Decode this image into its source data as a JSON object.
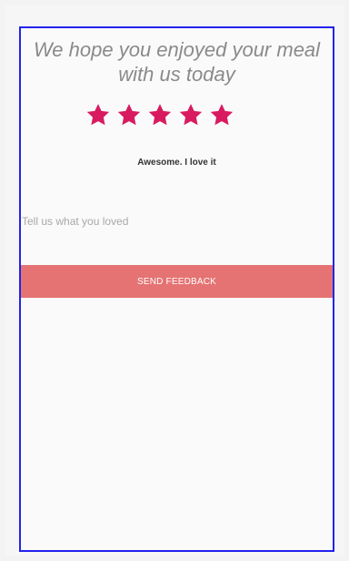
{
  "headline": "We hope you enjoyed your meal\nwith us today",
  "rating": {
    "value": 5,
    "max": 5,
    "star_color": "#d81b60",
    "text": "Awesome. I love it"
  },
  "feedback": {
    "placeholder": "Tell us what you loved",
    "value": ""
  },
  "send_button": {
    "label": "SEND FEEDBACK",
    "color": "#e57373"
  }
}
